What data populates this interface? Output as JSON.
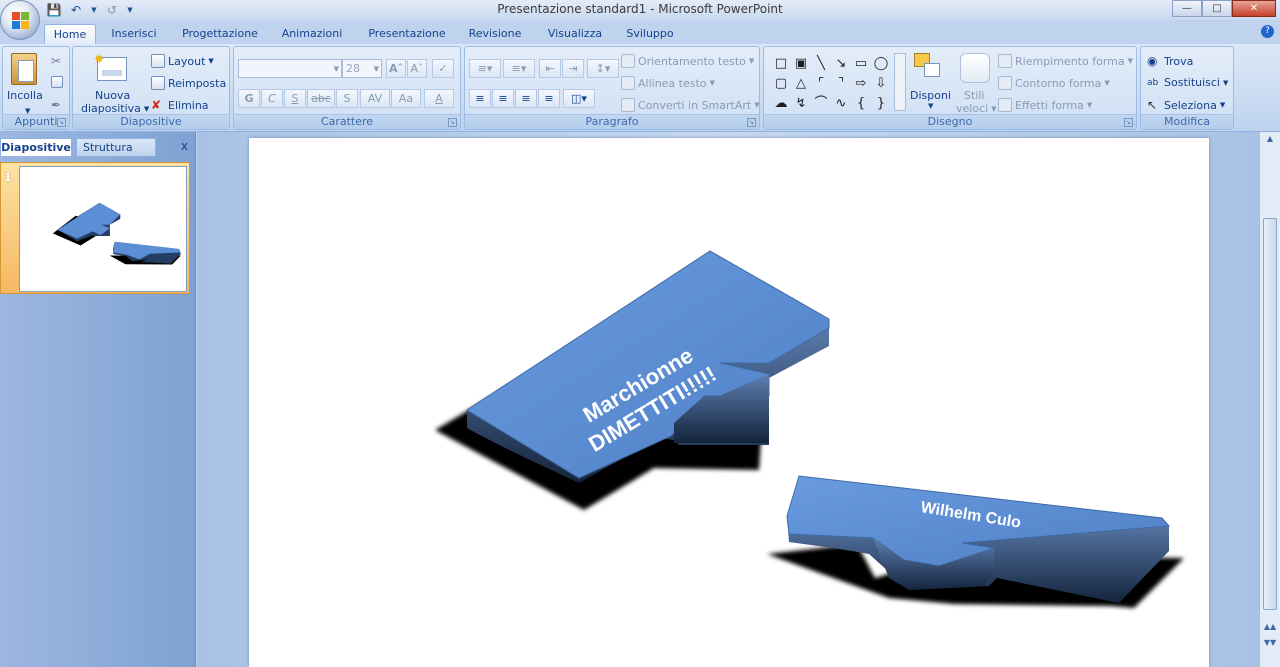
{
  "window": {
    "title": "Presentazione standard1 - Microsoft PowerPoint"
  },
  "tabs": [
    {
      "label": "Home",
      "active": true
    },
    {
      "label": "Inserisci"
    },
    {
      "label": "Progettazione"
    },
    {
      "label": "Animazioni"
    },
    {
      "label": "Presentazione"
    },
    {
      "label": "Revisione"
    },
    {
      "label": "Visualizza"
    },
    {
      "label": "Sviluppo"
    }
  ],
  "ribbon": {
    "appunti": {
      "label": "Appunti",
      "paste": "Incolla"
    },
    "diapositive": {
      "label": "Diapositive",
      "new_slide_line1": "Nuova",
      "new_slide_line2": "diapositiva",
      "layout": "Layout",
      "reset": "Reimposta",
      "delete": "Elimina"
    },
    "carattere": {
      "label": "Carattere",
      "font_size": "28",
      "bold": "G",
      "italic": "C",
      "underline": "S",
      "strike": "abc",
      "shadow": "S",
      "spacing": "AV",
      "case": "Aa",
      "color": "A"
    },
    "paragrafo": {
      "label": "Paragrafo",
      "text_direction": "Orientamento testo",
      "align_text": "Allinea testo",
      "smartart": "Converti in SmartArt"
    },
    "disegno": {
      "label": "Disegno",
      "arrange": "Disponi",
      "quick_styles_line1": "Stili",
      "quick_styles_line2": "veloci",
      "fill": "Riempimento forma",
      "outline": "Contorno forma",
      "effects": "Effetti forma"
    },
    "modifica": {
      "label": "Modifica",
      "find": "Trova",
      "replace": "Sostituisci",
      "select": "Seleziona"
    }
  },
  "left_pane": {
    "tab_slides": "Diapositive",
    "tab_outline": "Struttura",
    "close": "x",
    "slide_number": "1"
  },
  "slide": {
    "shape1_text_line1": "Marchionne",
    "shape1_text_line2": "DIMETTITI!!!!!",
    "shape2_text": "Wilhelm Culo",
    "shape_color": "#5b8ed4",
    "shape_side_color": "#233d63"
  }
}
